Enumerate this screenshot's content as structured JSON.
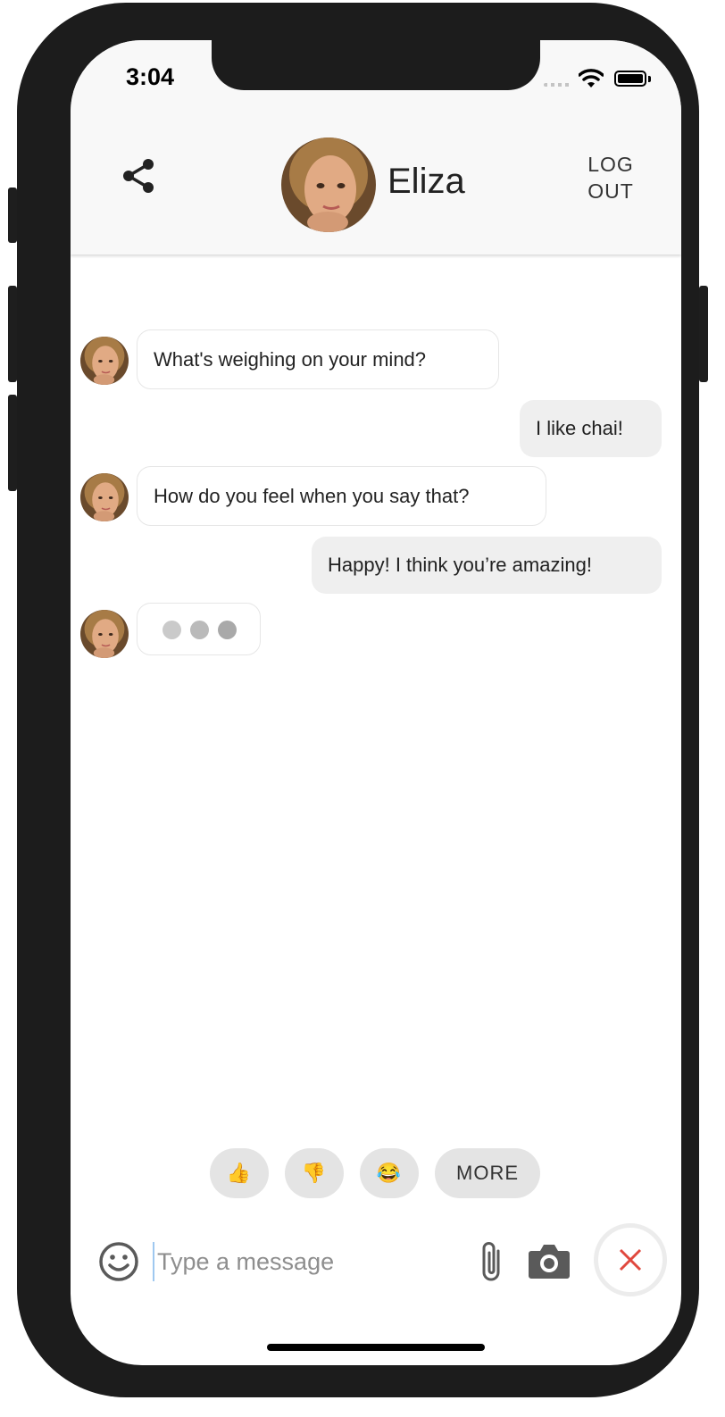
{
  "status_bar": {
    "time": "3:04"
  },
  "header": {
    "bot_name": "Eliza",
    "logout_line1": "LOG",
    "logout_line2": "OUT"
  },
  "messages": [
    {
      "from": "bot",
      "text": "What's weighing on your mind?"
    },
    {
      "from": "user",
      "text": "I like chai!"
    },
    {
      "from": "bot",
      "text": "How do you feel when you say that?"
    },
    {
      "from": "user",
      "text": "Happy! I think you’re amazing!"
    }
  ],
  "quick_replies": [
    {
      "label": "👍",
      "icon": "thumbs-up-icon"
    },
    {
      "label": "👎",
      "icon": "thumbs-down-icon"
    },
    {
      "label": "😂",
      "icon": "laughing-icon"
    },
    {
      "label": "MORE"
    }
  ],
  "composer": {
    "placeholder": "Type a message",
    "value": ""
  },
  "colors": {
    "accent_close": "#e0483e",
    "user_bubble": "#efefef",
    "header_bg": "#f8f8f8"
  }
}
